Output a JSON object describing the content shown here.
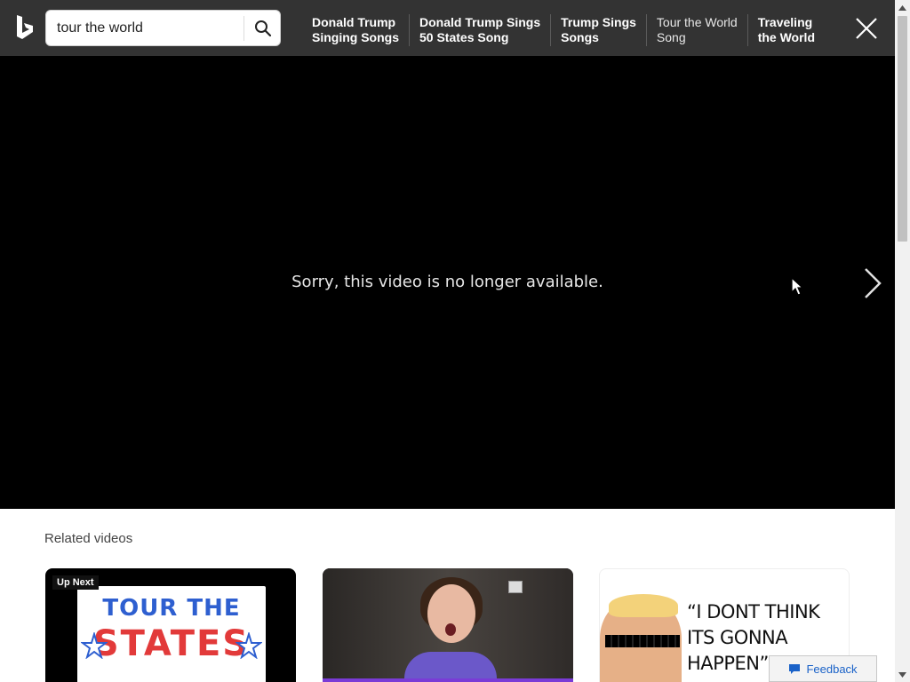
{
  "search": {
    "value": "tour the world"
  },
  "related_terms": [
    {
      "label": "Donald Trump\nSinging Songs",
      "bold": true
    },
    {
      "label": "Donald Trump Sings\n50 States Song",
      "bold": true
    },
    {
      "label": "Trump Sings\nSongs",
      "bold": true
    },
    {
      "label": "Tour the World\nSong",
      "bold": false
    },
    {
      "label": "Traveling\nthe World",
      "bold": true
    }
  ],
  "player": {
    "message": "Sorry, this video is no longer available."
  },
  "related": {
    "title": "Related videos",
    "cards": [
      {
        "badge": "Up Next",
        "line1": "TOUR THE",
        "line2": "STATES"
      },
      {},
      {
        "quote": "“I DONT THINK ITS GONNA HAPPEN”"
      }
    ]
  },
  "feedback": {
    "label": "Feedback"
  },
  "colors": {
    "topbar": "#333333",
    "player": "#000000",
    "feedback_text": "#1a62c8"
  }
}
